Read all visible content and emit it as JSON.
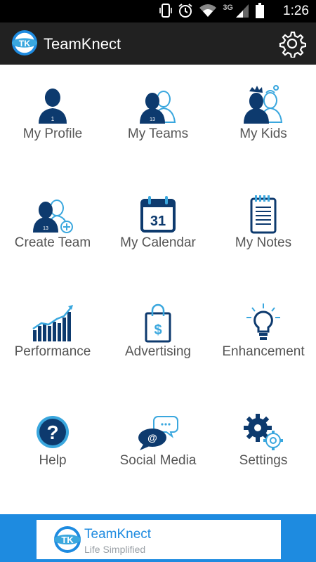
{
  "status_bar": {
    "time": "1:26",
    "network": "3G",
    "icons": [
      "vibrate-icon",
      "alarm-icon",
      "wifi-icon",
      "signal-icon",
      "battery-icon"
    ]
  },
  "app_bar": {
    "logo_text": "TK",
    "title": "TeamKnect",
    "settings_icon": "gear-icon"
  },
  "menu": [
    {
      "label": "My Profile",
      "icon": "person-icon"
    },
    {
      "label": "My Teams",
      "icon": "team-icon"
    },
    {
      "label": "My Kids",
      "icon": "kids-icon"
    },
    {
      "label": "Create Team",
      "icon": "add-team-icon"
    },
    {
      "label": "My Calendar",
      "icon": "calendar-icon",
      "icon_text": "31"
    },
    {
      "label": "My Notes",
      "icon": "notepad-icon"
    },
    {
      "label": "Performance",
      "icon": "chart-icon"
    },
    {
      "label": "Advertising",
      "icon": "shopping-bag-icon",
      "icon_text": "$"
    },
    {
      "label": "Enhancement",
      "icon": "lightbulb-icon"
    },
    {
      "label": "Help",
      "icon": "question-icon",
      "icon_text": "?"
    },
    {
      "label": "Social Media",
      "icon": "chat-bubbles-icon",
      "icon_text": "@"
    },
    {
      "label": "Settings",
      "icon": "gears-icon"
    }
  ],
  "banner": {
    "logo_text": "TK",
    "title": "TeamKnect",
    "subtitle": "Life Simplified"
  },
  "colors": {
    "navy": "#0d3a6e",
    "accent": "#3aa7de",
    "app_bar": "#212121",
    "footer": "#1e8be0"
  }
}
